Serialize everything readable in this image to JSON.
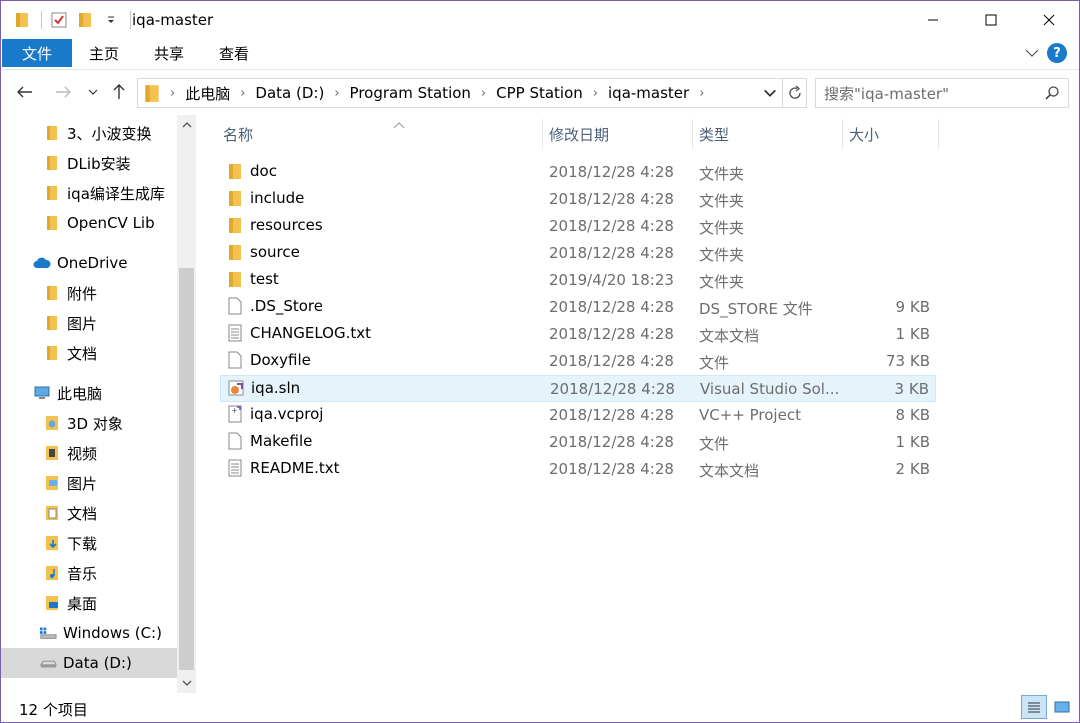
{
  "window": {
    "title": "iqa-master"
  },
  "ribbon": {
    "tabs": [
      {
        "label": "文件"
      },
      {
        "label": "主页"
      },
      {
        "label": "共享"
      },
      {
        "label": "查看"
      }
    ],
    "help": "?"
  },
  "address": {
    "crumbs": [
      "此电脑",
      "Data (D:)",
      "Program Station",
      "CPP Station",
      "iqa-master"
    ]
  },
  "search": {
    "placeholder": "搜索\"iqa-master\""
  },
  "nav": {
    "items": [
      {
        "label": "3、小波变换",
        "icon": "folder-icon"
      },
      {
        "label": "DLib安装",
        "icon": "folder-icon"
      },
      {
        "label": "iqa编译生成库",
        "icon": "folder-icon"
      },
      {
        "label": "OpenCV Lib",
        "icon": "folder-icon"
      },
      {
        "label": "OneDrive",
        "icon": "cloud-icon"
      },
      {
        "label": "附件",
        "icon": "folder-icon"
      },
      {
        "label": "图片",
        "icon": "folder-icon"
      },
      {
        "label": "文档",
        "icon": "folder-icon"
      },
      {
        "label": "此电脑",
        "icon": "computer-icon"
      },
      {
        "label": "3D 对象",
        "icon": "3d-objects-icon"
      },
      {
        "label": "视频",
        "icon": "video-folder-icon"
      },
      {
        "label": "图片",
        "icon": "pictures-folder-icon"
      },
      {
        "label": "文档",
        "icon": "documents-folder-icon"
      },
      {
        "label": "下载",
        "icon": "downloads-folder-icon"
      },
      {
        "label": "音乐",
        "icon": "music-folder-icon"
      },
      {
        "label": "桌面",
        "icon": "desktop-folder-icon"
      },
      {
        "label": "Windows (C:)",
        "icon": "windows-drive-icon"
      },
      {
        "label": "Data (D:)",
        "icon": "drive-icon"
      }
    ]
  },
  "columns": {
    "name": "名称",
    "date": "修改日期",
    "type": "类型",
    "size": "大小"
  },
  "files": [
    {
      "name": "doc",
      "date": "2018/12/28 4:28",
      "type": "文件夹",
      "size": "",
      "icon": "folder-icon"
    },
    {
      "name": "include",
      "date": "2018/12/28 4:28",
      "type": "文件夹",
      "size": "",
      "icon": "folder-icon"
    },
    {
      "name": "resources",
      "date": "2018/12/28 4:28",
      "type": "文件夹",
      "size": "",
      "icon": "folder-icon"
    },
    {
      "name": "source",
      "date": "2018/12/28 4:28",
      "type": "文件夹",
      "size": "",
      "icon": "folder-icon"
    },
    {
      "name": "test",
      "date": "2019/4/20 18:23",
      "type": "文件夹",
      "size": "",
      "icon": "folder-icon"
    },
    {
      "name": ".DS_Store",
      "date": "2018/12/28 4:28",
      "type": "DS_STORE 文件",
      "size": "9 KB",
      "icon": "blank-file-icon"
    },
    {
      "name": "CHANGELOG.txt",
      "date": "2018/12/28 4:28",
      "type": "文本文档",
      "size": "1 KB",
      "icon": "text-file-icon"
    },
    {
      "name": "Doxyfile",
      "date": "2018/12/28 4:28",
      "type": "文件",
      "size": "73 KB",
      "icon": "blank-file-icon"
    },
    {
      "name": "iqa.sln",
      "date": "2018/12/28 4:28",
      "type": "Visual Studio Sol...",
      "size": "3 KB",
      "icon": "vs-solution-icon"
    },
    {
      "name": "iqa.vcproj",
      "date": "2018/12/28 4:28",
      "type": "VC++ Project",
      "size": "8 KB",
      "icon": "vcproj-file-icon"
    },
    {
      "name": "Makefile",
      "date": "2018/12/28 4:28",
      "type": "文件",
      "size": "1 KB",
      "icon": "blank-file-icon"
    },
    {
      "name": "README.txt",
      "date": "2018/12/28 4:28",
      "type": "文本文档",
      "size": "2 KB",
      "icon": "text-file-icon"
    }
  ],
  "status": {
    "count": "12 个项目"
  },
  "colors": {
    "accent": "#1979ca",
    "folder": "#f2c14e",
    "selected_row": "#e5f3fb",
    "nav_selected": "#d9d9d9",
    "header_text": "#4c607a"
  }
}
